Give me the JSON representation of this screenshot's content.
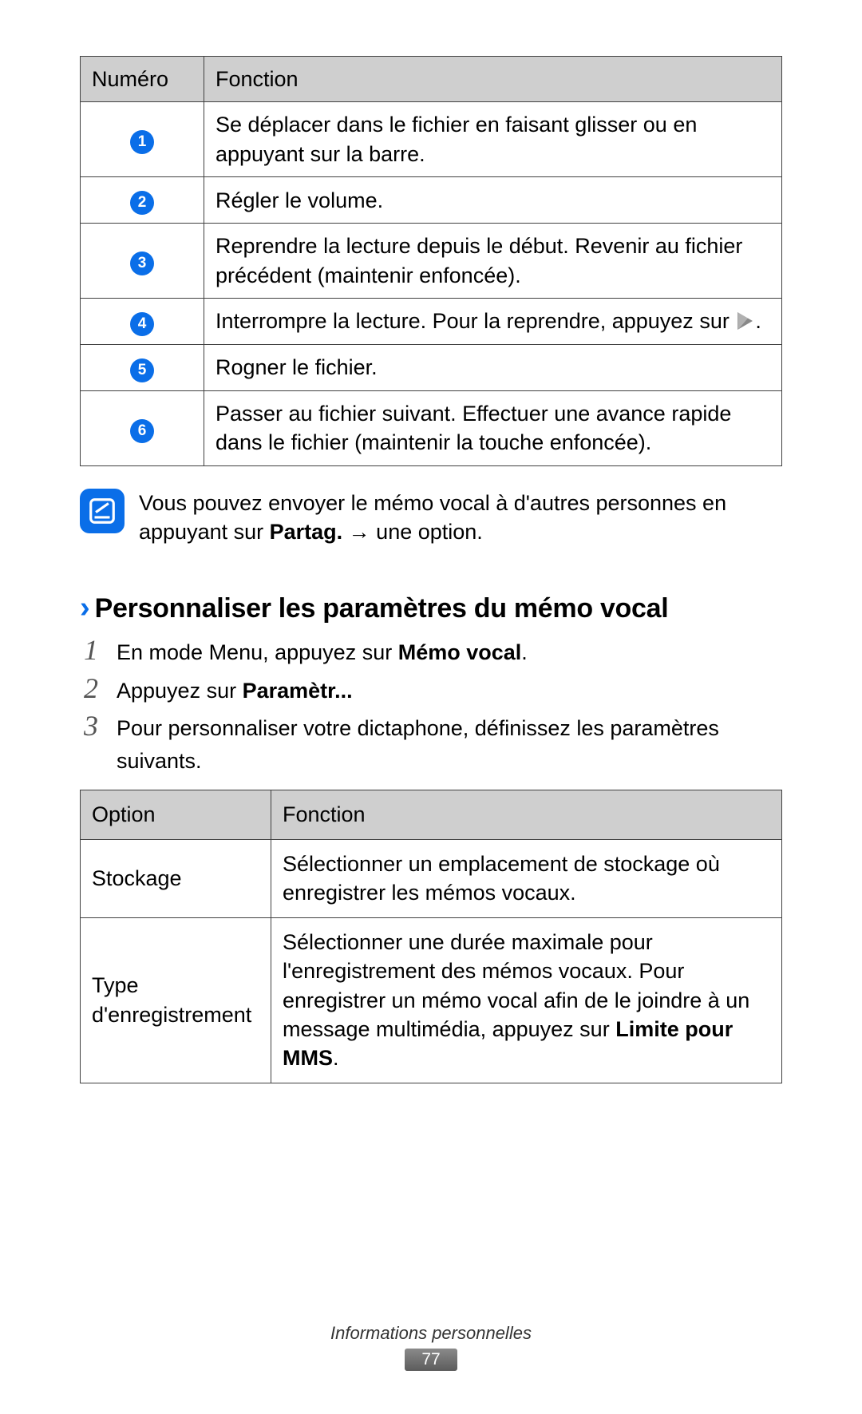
{
  "table1": {
    "head": {
      "num": "Numéro",
      "fn": "Fonction"
    },
    "rows": [
      {
        "n": "1",
        "fn": "Se déplacer dans le fichier en faisant glisser ou en appuyant sur la barre."
      },
      {
        "n": "2",
        "fn": "Régler le volume."
      },
      {
        "n": "3",
        "fn": "Reprendre la lecture depuis le début. Revenir au fichier précédent (maintenir enfoncée)."
      },
      {
        "n": "4",
        "fn_pre": "Interrompre la lecture. Pour la reprendre, appuyez sur ",
        "fn_post": "."
      },
      {
        "n": "5",
        "fn": "Rogner le fichier."
      },
      {
        "n": "6",
        "fn": "Passer au fichier suivant. Effectuer une avance rapide dans le fichier (maintenir la touche enfoncée)."
      }
    ]
  },
  "note": {
    "pre": "Vous pouvez envoyer le mémo vocal à d'autres personnes en appuyant sur ",
    "bold": "Partag.",
    "arrow": " → ",
    "post": "une option."
  },
  "heading": {
    "chevron": "›",
    "text": "Personnaliser les paramètres du mémo vocal"
  },
  "steps": {
    "s1": {
      "num": "1",
      "pre": "En mode Menu, appuyez sur ",
      "bold": "Mémo vocal",
      "post": "."
    },
    "s2": {
      "num": "2",
      "pre": "Appuyez sur ",
      "bold": "Paramètr..."
    },
    "s3": {
      "num": "3",
      "text": "Pour personnaliser votre dictaphone, définissez les paramètres suivants."
    }
  },
  "table2": {
    "head": {
      "opt": "Option",
      "fn": "Fonction"
    },
    "rows": [
      {
        "opt": "Stockage",
        "fn": "Sélectionner un emplacement de stockage où enregistrer les mémos vocaux."
      },
      {
        "opt": "Type d'enregistrement",
        "fn_pre": "Sélectionner une durée maximale pour l'enregistrement des mémos vocaux. Pour enregistrer un mémo vocal afin de le joindre à un message multimédia, appuyez sur ",
        "fn_bold": "Limite pour MMS",
        "fn_post": "."
      }
    ]
  },
  "footer": {
    "section": "Informations personnelles",
    "page": "77"
  }
}
